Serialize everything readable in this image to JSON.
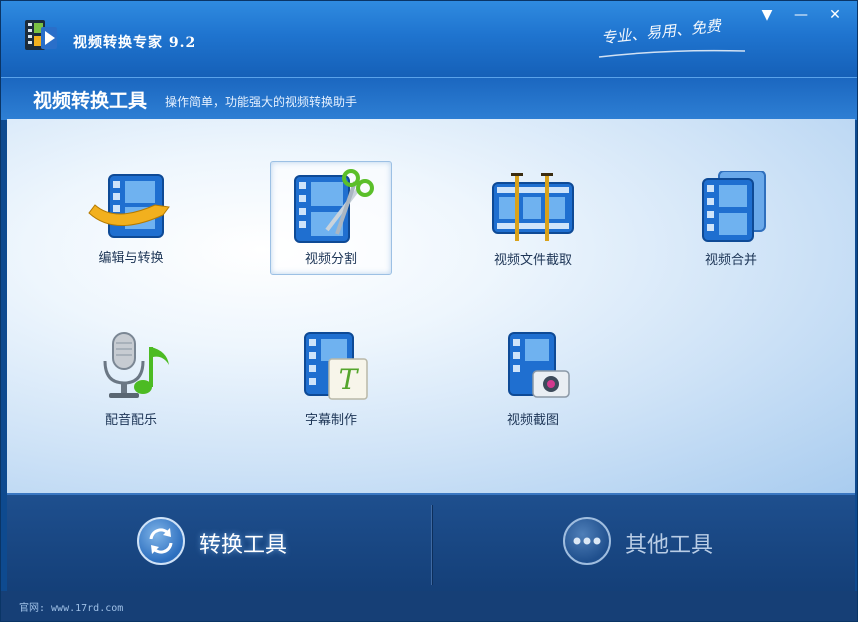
{
  "window": {
    "title": "视频转换专家 9.2",
    "tagline": "专业、易用、免费",
    "controls": {
      "menu": "▼",
      "minimize": "—",
      "close": "✕"
    }
  },
  "header": {
    "title": "视频转换工具",
    "subtitle": "操作简单，功能强大的视频转换助手"
  },
  "tools": [
    {
      "label": "编辑与转换",
      "icon": "film-convert-icon"
    },
    {
      "label": "视频分割",
      "icon": "film-scissors-icon",
      "selected": true
    },
    {
      "label": "视频文件截取",
      "icon": "film-trim-icon"
    },
    {
      "label": "视频合并",
      "icon": "film-merge-icon"
    },
    {
      "label": "配音配乐",
      "icon": "microphone-music-icon"
    },
    {
      "label": "字幕制作",
      "icon": "film-subtitle-icon"
    },
    {
      "label": "视频截图",
      "icon": "film-camera-icon"
    }
  ],
  "bottom_tabs": [
    {
      "label": "转换工具",
      "icon": "convert-arrows-icon",
      "active": true
    },
    {
      "label": "其他工具",
      "icon": "more-dots-icon",
      "active": false
    }
  ],
  "footer": {
    "text": "官网: www.17rd.com"
  },
  "colors": {
    "accent": "#1f74cf",
    "panel": "#143f78",
    "active_tab_text": "#ffffff",
    "inactive_tab_text": "#b9cde6"
  }
}
